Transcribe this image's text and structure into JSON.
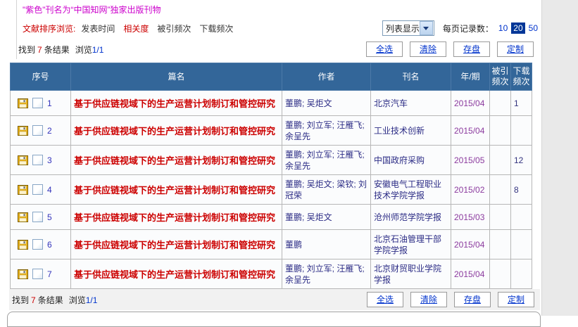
{
  "colors": {
    "notice_magenta": "#cc00cc",
    "accent_red": "#cc0000",
    "table_header_bg": "#336699",
    "link_blue": "#0033cc",
    "selected_page_bg": "#003697",
    "title_red": "#cc0000",
    "author_navy": "#2b2b85",
    "year_purple": "#8b3a9e"
  },
  "notice": "\"紫色\"刊名为“中国知网”独家出版刊物",
  "sort_bar": {
    "label": "文献排序浏览:",
    "options": [
      {
        "label": "发表时间",
        "active": false
      },
      {
        "label": "相关度",
        "active": true
      },
      {
        "label": "被引频次",
        "active": false
      },
      {
        "label": "下载频次",
        "active": false
      }
    ]
  },
  "display_mode": {
    "value": "列表显示"
  },
  "page_size": {
    "label": "每页记录数：",
    "options": [
      "10",
      "20",
      "50"
    ],
    "selected": "20"
  },
  "results": {
    "found_prefix": "找到",
    "count": "7",
    "found_suffix": "条结果",
    "browse_label": "浏览",
    "browse_page": "1/1"
  },
  "actions": {
    "select_all": "全选",
    "clear": "清除",
    "save": "存盘",
    "customize": "定制"
  },
  "table": {
    "headers": [
      "序号",
      "篇名",
      "作者",
      "刊名",
      "年/期",
      "被引频次",
      "下载频次"
    ],
    "rows": [
      {
        "num": "1",
        "title": "基于供应链视域下的生产运营计划制订和管控研究",
        "authors": "董鹏; 吴炬文",
        "journal": "北京汽车",
        "year": "2015/04",
        "cited": "",
        "downloads": "1"
      },
      {
        "num": "2",
        "title": "基于供应链视域下的生产运营计划制订和管控研究",
        "authors": "董鹏; 刘立军; 汪雁飞; 余呈先",
        "journal": "工业技术创新",
        "year": "2015/04",
        "cited": "",
        "downloads": ""
      },
      {
        "num": "3",
        "title": "基于供应链视域下的生产运营计划制订和管控研究",
        "authors": "董鹏; 刘立军; 汪雁飞; 余呈先",
        "journal": "中国政府采购",
        "year": "2015/05",
        "cited": "",
        "downloads": "12"
      },
      {
        "num": "4",
        "title": "基于供应链视域下的生产运营计划制订和管控研究",
        "authors": "董鹏; 吴炬文; 梁钦; 刘冠荣",
        "journal": "安徽电气工程职业技术学院学报",
        "year": "2015/02",
        "cited": "",
        "downloads": "8"
      },
      {
        "num": "5",
        "title": "基于供应链视域下的生产运营计划制订和管控研究",
        "authors": "董鹏; 吴炬文",
        "journal": "沧州师范学院学报",
        "year": "2015/03",
        "cited": "",
        "downloads": ""
      },
      {
        "num": "6",
        "title": "基于供应链视域下的生产运营计划制订和管控研究",
        "authors": "董鹏",
        "journal": "北京石油管理干部学院学报",
        "year": "2015/04",
        "cited": "",
        "downloads": ""
      },
      {
        "num": "7",
        "title": "基于供应链视域下的生产运营计划制订和管控研究",
        "authors": "董鹏; 刘立军; 汪雁飞; 余呈先",
        "journal": "北京财贸职业学院学报",
        "year": "2015/04",
        "cited": "",
        "downloads": ""
      }
    ]
  }
}
